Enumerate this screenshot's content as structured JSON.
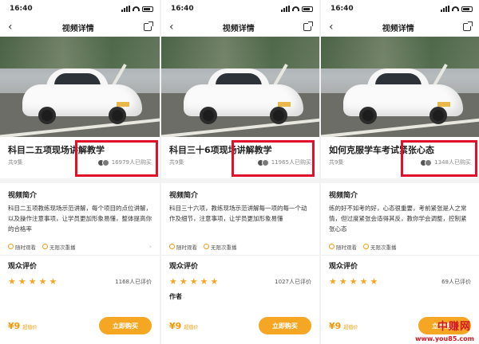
{
  "status_time": "16:40",
  "nav_title": "视频详情",
  "screens": [
    {
      "title": "科目二五项现场讲解教学",
      "lesson_count": "共9集",
      "buyers": "16979人已购买",
      "intro_heading": "视频简介",
      "intro": "科目二五项教练现场示范讲解，每个项目的点位讲解，以及操作注意事项，让学员更加形象易懂，整体提高你的合格率",
      "tag1": "随时观看",
      "tag2": "无限次重播",
      "reviews_heading": "观众评价",
      "stars": 5,
      "review_count": "1168人已评价",
      "author_label": "",
      "price": "¥9",
      "price_tag": "超值价",
      "buy_label": "立即购买"
    },
    {
      "title": "科目三十6项现场讲解教学",
      "lesson_count": "共9集",
      "buyers": "11965人已购买",
      "intro_heading": "视频简介",
      "intro": "科目三十六项，教练现场示范讲解每一项的每一个动作及细节，注意事项，让学员更加形象易懂",
      "tag1": "随时观看",
      "tag2": "无限次重播",
      "reviews_heading": "观众评价",
      "stars": 5,
      "review_count": "1027人已评价",
      "author_label": "作者",
      "price": "¥9",
      "price_tag": "超值价",
      "buy_label": "立即购买"
    },
    {
      "title": "如何克服学车考试紧张心态",
      "lesson_count": "共9集",
      "buyers": "1348人已购买",
      "intro_heading": "视频简介",
      "intro": "练的好不如考的好，心态很重要，考前紧张是人之常情，但过度紧张会适得其反，教你学会调整，控制紧张心态",
      "tag1": "随时观看",
      "tag2": "无限次重播",
      "reviews_heading": "观众评价",
      "stars": 5,
      "review_count": "69人已评价",
      "author_label": "",
      "price": "¥9",
      "price_tag": "超值价",
      "buy_label": "立即购买"
    }
  ],
  "watermark_brand": "中赚网",
  "watermark_site": "www.you85.com",
  "colors": {
    "accent": "#f5a623",
    "highlight": "#e0102a"
  }
}
